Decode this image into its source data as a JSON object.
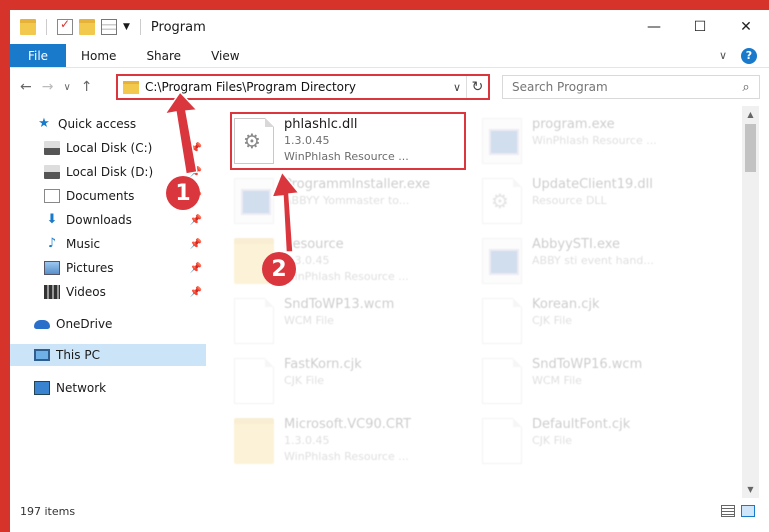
{
  "window": {
    "title": "Program",
    "minimize": "—",
    "maximize": "☐",
    "close": "✕"
  },
  "ribbon": {
    "file": "File",
    "tabs": [
      "Home",
      "Share",
      "View"
    ],
    "expand": "∨",
    "help": "?"
  },
  "nav": {
    "back": "←",
    "forward": "→",
    "recent": "∨",
    "up": "↑"
  },
  "address": {
    "path": "C:\\Program Files\\Program Directory",
    "dropdown": "∨",
    "refresh": "↻"
  },
  "search": {
    "placeholder": "Search Program",
    "icon": "⌕"
  },
  "sidebar": {
    "items": [
      {
        "label": "Quick access",
        "icon": "star-icon"
      },
      {
        "label": "Local Disk (C:)",
        "icon": "drive-icon",
        "pinned": true
      },
      {
        "label": "Local Disk (D:)",
        "icon": "drive-icon",
        "pinned": true
      },
      {
        "label": "Documents",
        "icon": "documents-icon",
        "pinned": true
      },
      {
        "label": "Downloads",
        "icon": "download-icon",
        "pinned": true
      },
      {
        "label": "Music",
        "icon": "music-icon",
        "pinned": true
      },
      {
        "label": "Pictures",
        "icon": "pictures-icon",
        "pinned": true
      },
      {
        "label": "Videos",
        "icon": "videos-icon",
        "pinned": true
      },
      {
        "label": "OneDrive",
        "icon": "cloud-icon"
      },
      {
        "label": "This PC",
        "icon": "computer-icon"
      },
      {
        "label": "Network",
        "icon": "network-icon"
      }
    ],
    "pin_glyph": "📌"
  },
  "files": [
    {
      "name": "phlashlc.dll",
      "line2": "1.3.0.45",
      "line3": "WinPhlash Resource ..."
    },
    {
      "name": "program.exe",
      "line2": "WinPhlash Resource ..."
    },
    {
      "name": "ProgrammInstaller.exe",
      "line2": "ABBYY Yommaster to..."
    },
    {
      "name": "UpdateClient19.dll",
      "line2": "Resource DLL"
    },
    {
      "name": "Resource",
      "line2": "1.3.0.45",
      "line3": "WinPhlash Resource ..."
    },
    {
      "name": "AbbyySTI.exe",
      "line2": "ABBY sti event hand..."
    },
    {
      "name": "SndToWP13.wcm",
      "line2": "WCM File"
    },
    {
      "name": "Korean.cjk",
      "line2": "CJK File"
    },
    {
      "name": "FastKorn.cjk",
      "line2": "CJK File"
    },
    {
      "name": "SndToWP16.wcm",
      "line2": "WCM File"
    },
    {
      "name": "Microsoft.VC90.CRT",
      "line2": "1.3.0.45",
      "line3": "WinPhlash Resource ..."
    },
    {
      "name": "DefaultFont.cjk",
      "line2": "CJK File"
    }
  ],
  "status": {
    "count": "197 items"
  },
  "annotations": {
    "step1": "1",
    "step2": "2",
    "color": "#d9363e"
  }
}
